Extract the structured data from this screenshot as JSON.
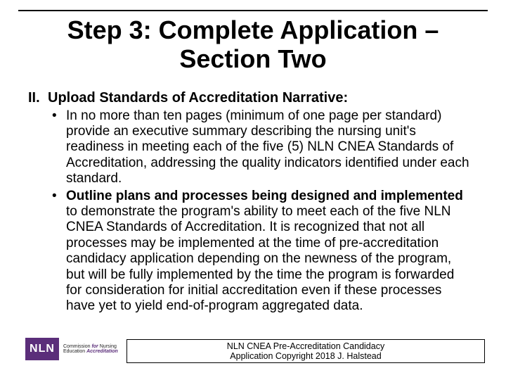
{
  "title_line1": "Step 3: Complete Application –",
  "title_line2": "Section Two",
  "section": {
    "number": "II.",
    "heading": "Upload Standards of Accreditation Narrative:"
  },
  "bullet1": "In no more than ten pages (minimum of one page  per standard) provide an executive summary describing  the nursing unit's readiness in meeting each of the five (5) NLN CNEA Standards of Accreditation, addressing the quality indicators identified under each standard.",
  "bullet2_lead": "Outline plans and processes being designed and implemented",
  "bullet2_rest": " to demonstrate the program's ability to meet each of the five NLN CNEA Standards of Accreditation.  It is recognized that not all processes may be implemented at the time of pre-accreditation candidacy application depending on the newness of the program, but will be fully implemented by the time the program is forwarded for consideration for initial accreditation even if these processes have yet to yield end-of-program aggregated data.",
  "logo": {
    "abbrev": "NLN",
    "line1a": "Commission ",
    "line1b": "for",
    "line1c": " Nursing",
    "line2a": "Education ",
    "line2b": "Accreditation"
  },
  "footer_line1": "NLN CNEA Pre-Accreditation Candidacy",
  "footer_line2": "Application   Copyright 2018 J. Halstead"
}
